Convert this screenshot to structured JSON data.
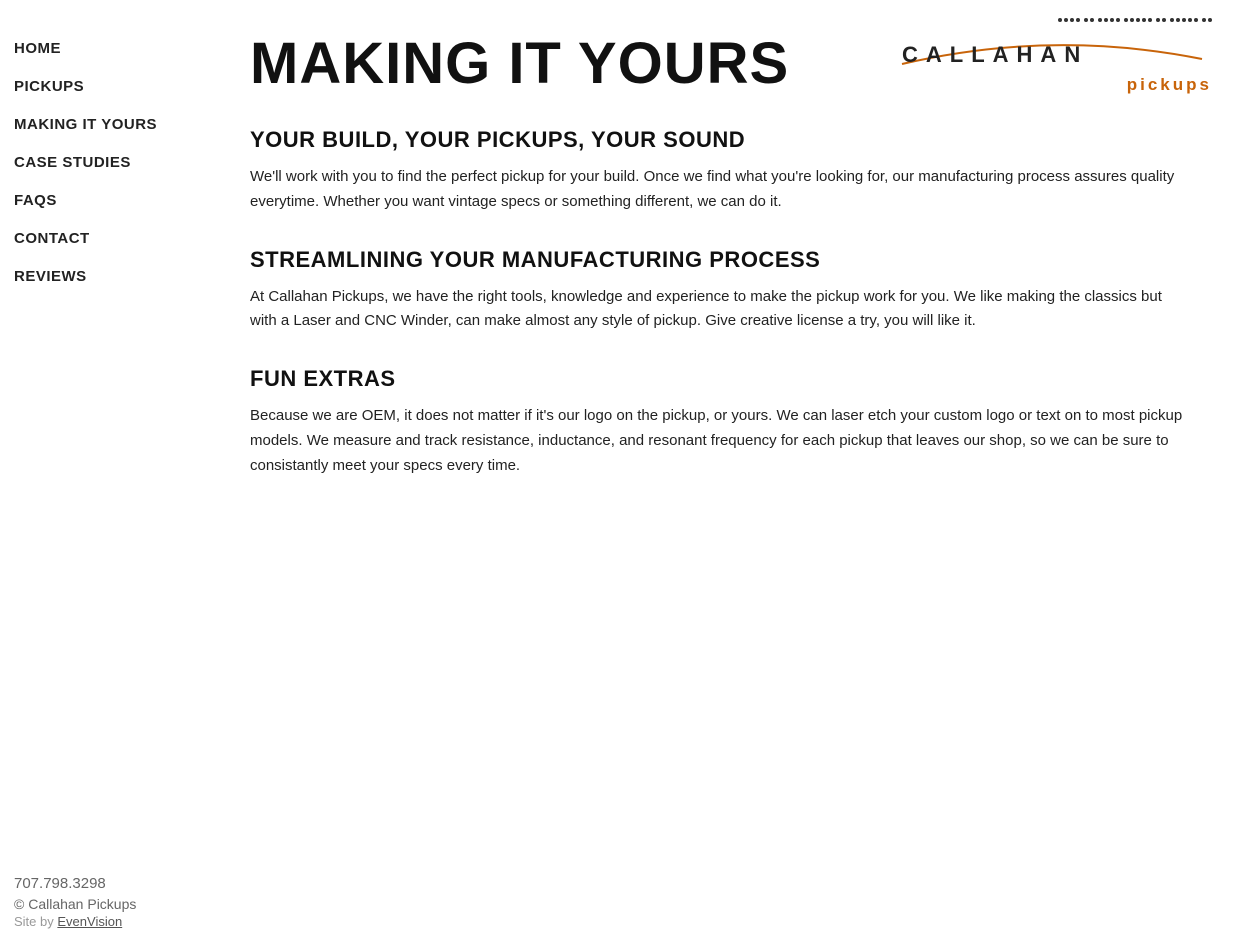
{
  "site": {
    "logo_text": "C A L L A H A N",
    "logo_pickups": "pickups",
    "phone": "707.798.3298",
    "copyright": "© Callahan Pickups",
    "site_by_label": "Site by",
    "site_by_link": "EvenVision"
  },
  "nav": {
    "items": [
      {
        "label": "HOME",
        "href": "#"
      },
      {
        "label": "PICKUPS",
        "href": "#"
      },
      {
        "label": "MAKING IT YOURS",
        "href": "#"
      },
      {
        "label": "CASE STUDIES",
        "href": "#"
      },
      {
        "label": "FAQS",
        "href": "#"
      },
      {
        "label": "CONTACT",
        "href": "#"
      },
      {
        "label": "REVIEWS",
        "href": "#"
      }
    ]
  },
  "page": {
    "title": "MAKING IT YOURS",
    "sections": [
      {
        "heading": "YOUR BUILD, YOUR PICKUPS, YOUR SOUND",
        "body": "We'll work with you to find the perfect pickup for your build.  Once we find what you're looking for, our manufacturing process assures quality everytime.  Whether you want vintage specs or something different, we can do it."
      },
      {
        "heading": "STREAMLINING YOUR MANUFACTURING PROCESS",
        "body": "At Callahan Pickups, we have the right tools, knowledge and experience to make the pickup work for you.  We like making the classics but with a Laser and CNC Winder, can make almost any style of pickup.  Give creative license a try, you will like it."
      },
      {
        "heading": "FUN EXTRAS",
        "body": "Because we are OEM, it does not matter if it's our logo on the pickup, or yours.  We can laser etch your custom logo or text on to most pickup models.  We measure and track resistance, inductance, and resonant frequency for each pickup that leaves our shop, so we can be sure to consistantly meet your specs every time."
      }
    ]
  }
}
